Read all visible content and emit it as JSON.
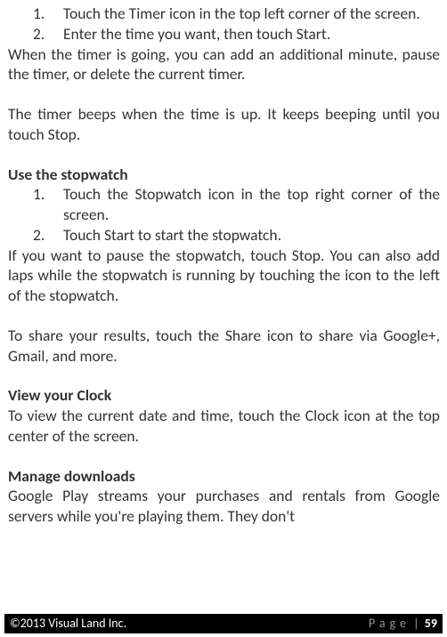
{
  "timer": {
    "steps": [
      "Touch the Timer icon in the top left corner of the screen.",
      "Enter the time you want, then touch Start."
    ],
    "para1": "When the timer is going, you can add an additional minute, pause the timer, or delete the current timer.",
    "para2": "The timer beeps when the time is up. It keeps beeping until you touch Stop."
  },
  "stopwatch": {
    "heading": "Use the stopwatch",
    "steps": [
      "Touch the Stopwatch icon in the top right corner of the screen.",
      "Touch Start to start the stopwatch."
    ],
    "para1": "If you want to pause the stopwatch, touch Stop. You can also add laps while the stopwatch is running by touching the icon to the left of the stopwatch.",
    "para2": "To share your results, touch the Share icon to share via Google+, Gmail, and more."
  },
  "clock": {
    "heading": "View your Clock",
    "para1": "To view the current date and time, touch the Clock icon at the top center of the screen."
  },
  "downloads": {
    "heading": "Manage downloads",
    "para1": "Google Play streams your purchases and rentals from Google servers while you're playing them. They don't"
  },
  "footer": {
    "copyright": "©2013 Visual Land Inc.",
    "pagelabel": "Page",
    "pipe": " | ",
    "pagenum": "59"
  }
}
